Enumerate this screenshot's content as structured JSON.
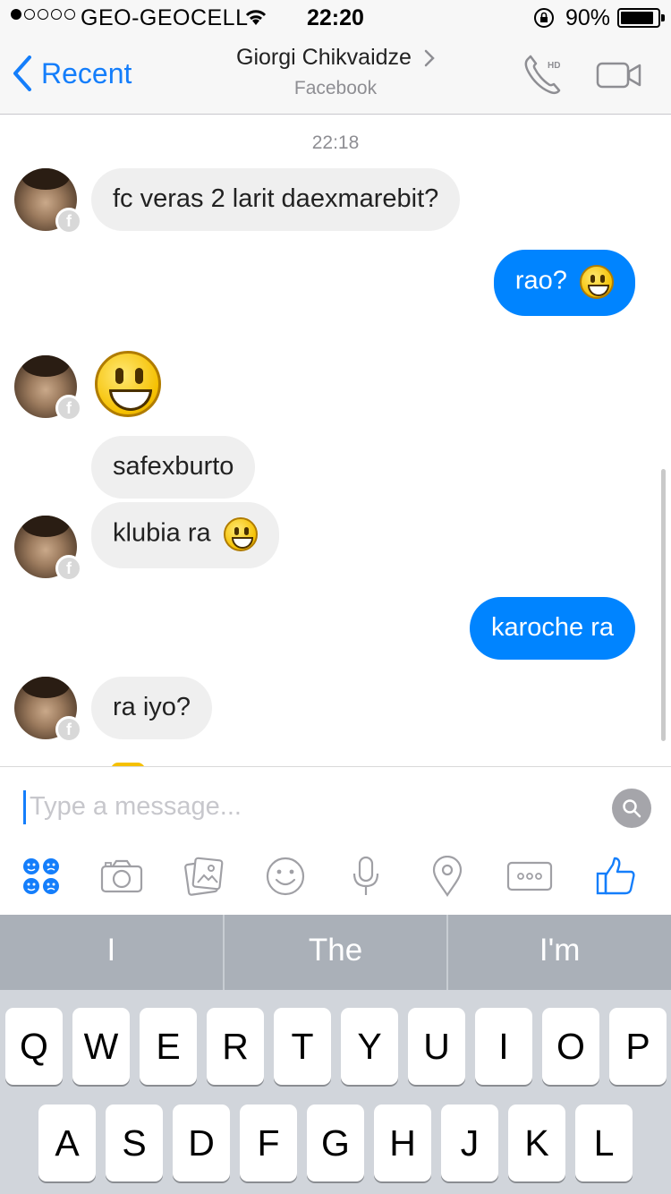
{
  "status_bar": {
    "carrier": "GEO-GEOCELL",
    "time": "22:20",
    "battery": "90%",
    "battery_level": 0.9
  },
  "nav": {
    "back_label": "Recent",
    "contact_name": "Giorgi Chikvaidze",
    "subtitle": "Facebook",
    "call_badge": "HD"
  },
  "chat": {
    "timestamp": "22:18",
    "messages": [
      {
        "from": "contact",
        "text": "fc veras 2 larit daexmarebit?"
      },
      {
        "from": "me",
        "text": "rao?",
        "emoji": "smiley"
      },
      {
        "from": "contact",
        "emoji": "smiley-large"
      },
      {
        "from": "contact",
        "text": "safexburto"
      },
      {
        "from": "contact",
        "text": "klubia ra",
        "emoji": "smiley"
      },
      {
        "from": "me",
        "text": "karoche ra"
      },
      {
        "from": "contact",
        "text": "ra iyo?"
      }
    ]
  },
  "composer": {
    "placeholder": "Type a message...",
    "toolbar_icons": [
      "stickers-icon",
      "camera-icon",
      "gallery-icon",
      "emoji-icon",
      "microphone-icon",
      "location-icon",
      "more-icon",
      "like-icon"
    ]
  },
  "keyboard": {
    "suggestions": [
      "I",
      "The",
      "I'm"
    ],
    "row1": [
      "Q",
      "W",
      "E",
      "R",
      "T",
      "Y",
      "U",
      "I",
      "O",
      "P"
    ],
    "row2": [
      "A",
      "S",
      "D",
      "F",
      "G",
      "H",
      "J",
      "K",
      "L"
    ]
  },
  "colors": {
    "accent": "#147efb",
    "outgoing_bubble": "#0084ff",
    "incoming_bubble": "#efefef"
  }
}
